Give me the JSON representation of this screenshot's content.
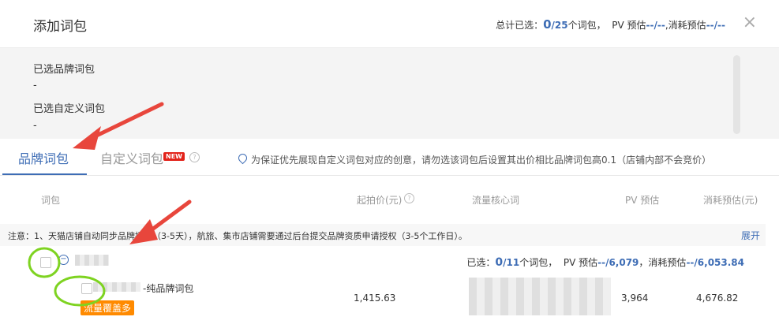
{
  "modal": {
    "title": "添加词包",
    "summary": {
      "prefix": "总计已选：",
      "selected": "0",
      "total": "/25",
      "unit": "个词包，",
      "pv_label": "PV 预估",
      "pv_value": "--/--",
      "cost_label": ",消耗预估",
      "cost_value": "--/--"
    },
    "close": "×"
  },
  "selected": {
    "brand_label": "已选品牌词包",
    "brand_value": "-",
    "custom_label": "已选自定义词包",
    "custom_value": "-"
  },
  "tabs": {
    "brand": "品牌词包",
    "custom": "自定义词包",
    "new_badge": "NEW",
    "help": "?",
    "notice": "为保证优先展现自定义词包对应的创意，请勿选该词包后设置其出价相比品牌词包高0.1（店铺内部不会竞价）"
  },
  "table": {
    "headers": {
      "keyword": "词包",
      "start_price": "起拍价(元)",
      "core_words": "流量核心词",
      "pv": "PV 预估",
      "cost": "消耗预估(元)"
    },
    "help": "?",
    "note": "注意：1、天猫店铺自动同步品牌授权（3-5天），航旅、集市店铺需要通过后台提交品牌资质申请授权（3-5个工作日）。",
    "expand": "展开",
    "group": {
      "toggle": "−",
      "stats_prefix": "已选：",
      "selected": "0",
      "total": "/11",
      "unit": "个词包，",
      "pv_label": "PV 预估",
      "pv_value": "--/6,079",
      "cost_label": "，消耗预估",
      "cost_value": "--/6,053.84"
    },
    "item": {
      "name_suffix": "-纯品牌词包",
      "tag": "流量覆盖多",
      "start_price": "1,415.63",
      "pv": "3,964",
      "cost": "4,676.82"
    }
  },
  "colors": {
    "accent": "#3e6db5",
    "annotation_red": "#e8463c",
    "annotation_green": "#7ed321",
    "tag_orange": "#ff8a00"
  }
}
